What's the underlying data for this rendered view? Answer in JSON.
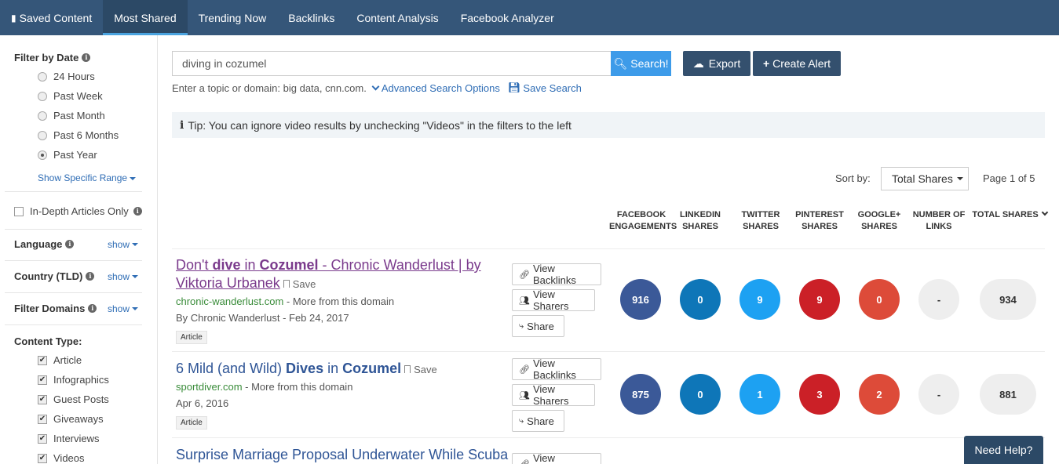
{
  "nav": {
    "tabs": [
      {
        "label": "Saved Content"
      },
      {
        "label": "Most Shared"
      },
      {
        "label": "Trending Now"
      },
      {
        "label": "Backlinks"
      },
      {
        "label": "Content Analysis"
      },
      {
        "label": "Facebook Analyzer"
      }
    ],
    "active_tab": "Most Shared"
  },
  "sidebar": {
    "filter_date_title": "Filter by Date",
    "date_options": [
      "24 Hours",
      "Past Week",
      "Past Month",
      "Past 6 Months",
      "Past Year"
    ],
    "selected_date": "Past Year",
    "show_range": "Show Specific Range",
    "in_depth": "In-Depth Articles Only",
    "language": "Language",
    "country": "Country (TLD)",
    "filter_domains": "Filter Domains",
    "show": "show",
    "content_type_title": "Content Type:",
    "content_types": [
      "Article",
      "Infographics",
      "Guest Posts",
      "Giveaways",
      "Interviews",
      "Videos"
    ]
  },
  "search": {
    "query": "diving in cozumel",
    "button": "Search!",
    "export": "Export",
    "create_alert": "Create Alert",
    "hint": "Enter a topic or domain: big data, cnn.com.",
    "advanced": "Advanced Search Options",
    "save_search": "Save Search"
  },
  "tip": "Tip: You can ignore video results by unchecking \"Videos\" in the filters to the left",
  "sort": {
    "label": "Sort by:",
    "value": "Total Shares",
    "page": "Page 1 of 5"
  },
  "columns": [
    [
      "FACEBOOK",
      "ENGAGEMENTS"
    ],
    [
      "LINKEDIN",
      "SHARES"
    ],
    [
      "TWITTER",
      "SHARES"
    ],
    [
      "PINTEREST",
      "SHARES"
    ],
    [
      "GOOGLE+",
      "SHARES"
    ],
    [
      "NUMBER OF",
      "LINKS"
    ],
    [
      "TOTAL SHARES",
      ""
    ]
  ],
  "articles": [
    {
      "title_parts": [
        "Don't ",
        "dive",
        " in ",
        "Cozumel",
        " - Chronic Wanderlust | by Viktoria Urbanek"
      ],
      "save": "Save",
      "domain": "chronic-wanderlust.com",
      "more": " - More from this domain",
      "byline": "By Chronic Wanderlust - Feb 24, 2017",
      "tag": "Article",
      "facebook": "916",
      "linkedin": "0",
      "twitter": "9",
      "pinterest": "9",
      "googleplus": "0",
      "links": "-",
      "total": "934"
    },
    {
      "title_parts": [
        "6 Mild (and Wild) ",
        "Dives",
        " in ",
        "Cozumel",
        ""
      ],
      "save": "Save",
      "domain": "sportdiver.com",
      "more": " - More from this domain",
      "byline": "Apr 6, 2016",
      "tag": "Article",
      "facebook": "875",
      "linkedin": "0",
      "twitter": "1",
      "pinterest": "3",
      "googleplus": "2",
      "links": "-",
      "total": "881"
    },
    {
      "title_parts": [
        "Surprise Marriage Proposal Underwater While Scuba",
        "",
        "",
        "",
        ""
      ]
    }
  ],
  "actions": {
    "view_backlinks": "View Backlinks",
    "view_sharers": "View Sharers",
    "share": "Share"
  },
  "help": "Need Help?"
}
